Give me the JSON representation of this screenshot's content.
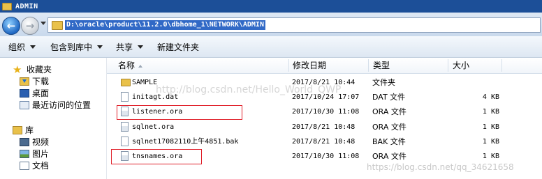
{
  "window": {
    "title": "ADMIN"
  },
  "address": {
    "path": "D:\\oracle\\product\\11.2.0\\dbhome_1\\NETWORK\\ADMIN"
  },
  "toolbar": {
    "organize": "组织",
    "include_in_library": "包含到库中",
    "share": "共享",
    "new_folder": "新建文件夹"
  },
  "sidebar": {
    "favorites": {
      "label": "收藏夹",
      "icon": "star-icon"
    },
    "favorites_items": [
      {
        "label": "下载",
        "icon": "downloads-icon"
      },
      {
        "label": "桌面",
        "icon": "desktop-icon"
      },
      {
        "label": "最近访问的位置",
        "icon": "recent-places-icon"
      }
    ],
    "libraries": {
      "label": "库",
      "icon": "library-icon"
    },
    "libraries_items": [
      {
        "label": "视频",
        "icon": "videos-icon"
      },
      {
        "label": "图片",
        "icon": "pictures-icon"
      },
      {
        "label": "文档",
        "icon": "documents-icon"
      }
    ]
  },
  "columns": {
    "name": "名称",
    "date": "修改日期",
    "type": "类型",
    "size": "大小"
  },
  "files": [
    {
      "name": "SAMPLE",
      "date": "2017/8/21 10:44",
      "type": "文件夹",
      "size": "",
      "icon": "folder-icon"
    },
    {
      "name": "initagt.dat",
      "date": "2017/10/24 17:07",
      "type": "DAT 文件",
      "size": "4 KB",
      "icon": "file-icon"
    },
    {
      "name": "listener.ora",
      "date": "2017/10/30 11:08",
      "type": "ORA 文件",
      "size": "1 KB",
      "icon": "file-icon"
    },
    {
      "name": "sqlnet.ora",
      "date": "2017/8/21 10:48",
      "type": "ORA 文件",
      "size": "1 KB",
      "icon": "file-icon"
    },
    {
      "name": "sqlnet17082110上午4851.bak",
      "date": "2017/8/21 10:48",
      "type": "BAK 文件",
      "size": "1 KB",
      "icon": "file-icon"
    },
    {
      "name": "tnsnames.ora",
      "date": "2017/10/30 11:08",
      "type": "ORA 文件",
      "size": "1 KB",
      "icon": "file-icon"
    }
  ],
  "watermarks": {
    "center": "http://blog.csdn.net/Hello_World_QWP",
    "bottom_right": "https://blog.csdn.net/qq_34621658"
  },
  "colors": {
    "titlebar": "#1c4f98",
    "address_highlight": "#3169c6",
    "annotation_box": "#e0202a"
  }
}
